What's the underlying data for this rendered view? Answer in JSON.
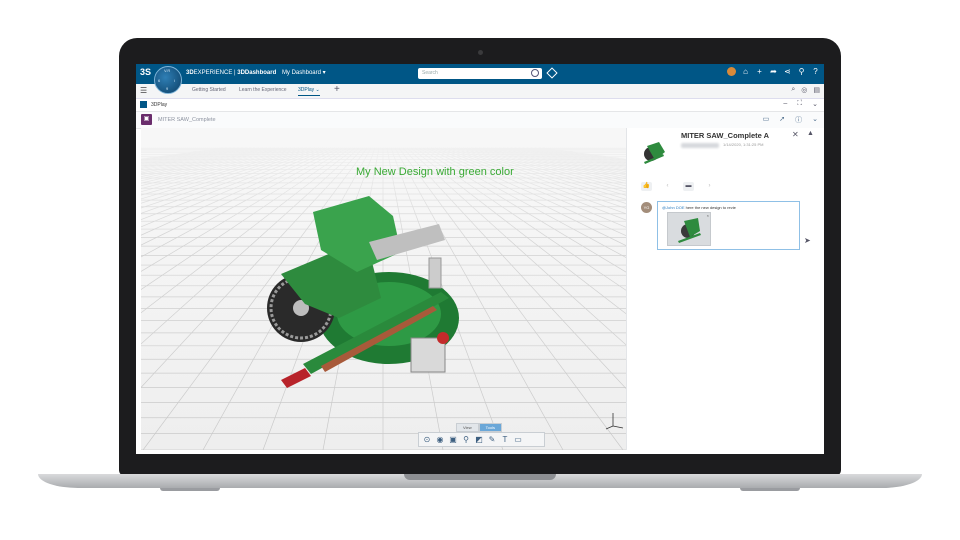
{
  "topbar": {
    "logo_text": "3S",
    "compass_labels": [
      "V.R",
      "6",
      "i",
      "9"
    ],
    "brand_bold": "3D",
    "brand_rest": "EXPERIENCE | ",
    "app_name": "3DDashboard",
    "dashboard_name": "My Dashboard",
    "search_placeholder": "Search",
    "icons": [
      "user-avatar",
      "bell-icon",
      "plus-icon",
      "share-icon",
      "network-icon",
      "antenna-icon",
      "help-icon"
    ]
  },
  "tabs": {
    "items": [
      {
        "label": "Getting Started"
      },
      {
        "label": "Learn the Experience"
      },
      {
        "label": "3DPlay"
      }
    ],
    "add_label": "+"
  },
  "widget": {
    "title": "3DPlay"
  },
  "document": {
    "title": "MITER SAW_Complete"
  },
  "viewport": {
    "annotation": "My New Design with green color",
    "annotation_color": "#3aaa35",
    "tool_tabs": [
      {
        "label": "View"
      },
      {
        "label": "Tools"
      }
    ],
    "toolbar_icons": [
      "select-icon",
      "visibility-icon",
      "fit-icon",
      "zoom-icon",
      "section-icon",
      "pen-icon",
      "text-icon",
      "comment-icon"
    ]
  },
  "panel": {
    "title": "MITER SAW_Complete A",
    "meta_time": "1/14/2020, 1:31:25 PM",
    "comment": {
      "avatar_initials": "YG",
      "mention": "@John DOE",
      "text": " here the new design to revie"
    }
  },
  "colors": {
    "topbar": "#005686",
    "accent": "#3aaa35",
    "model_green": "#2e8b3e"
  }
}
